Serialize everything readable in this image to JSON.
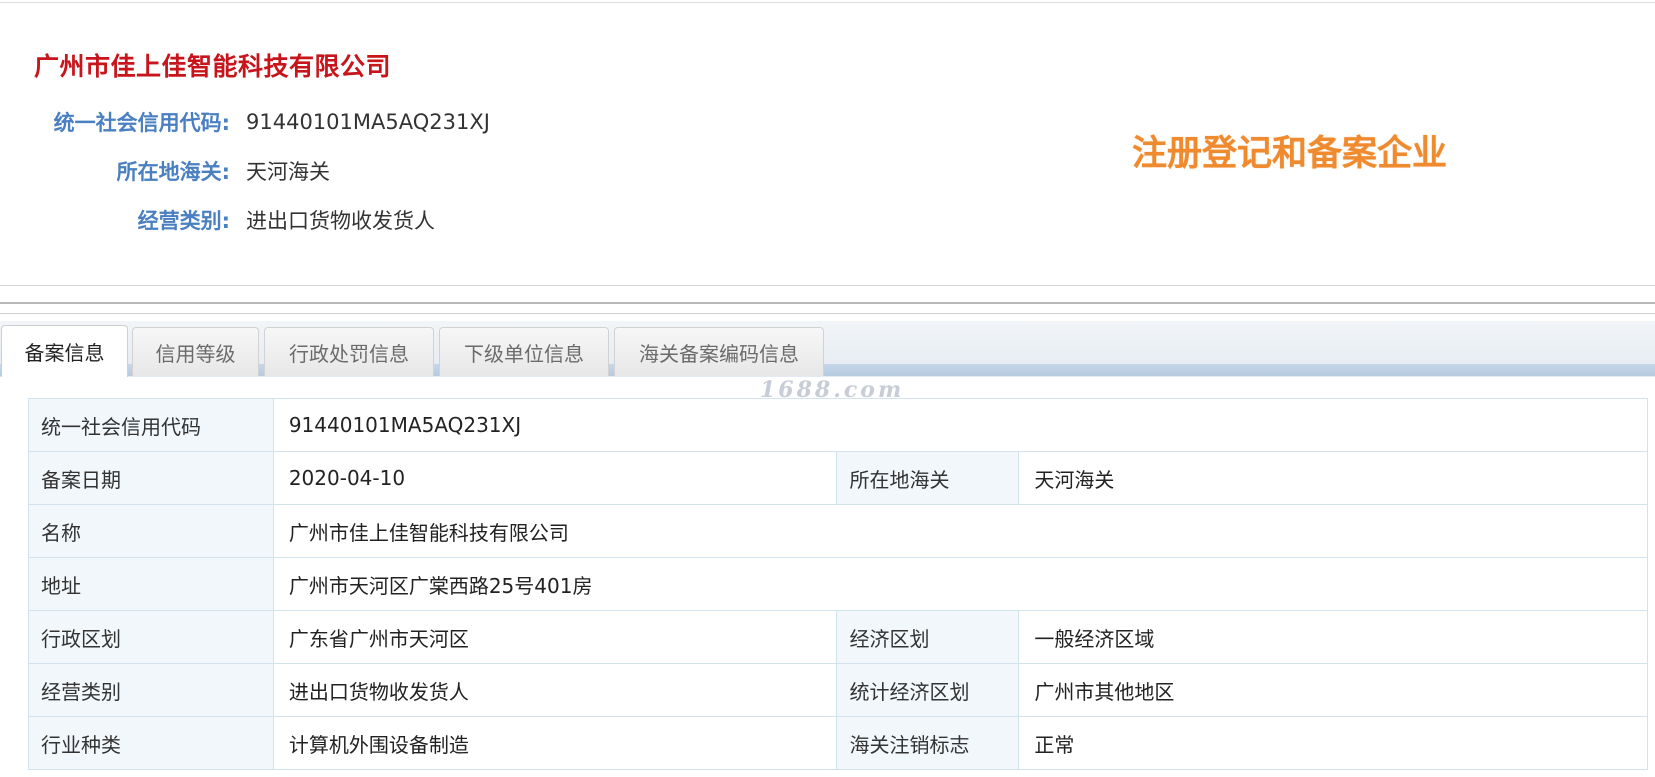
{
  "header": {
    "company_name": "广州市佳上佳智能科技有限公司",
    "fields": [
      {
        "label": "统一社会信用代码:",
        "value": "91440101MA5AQ231XJ"
      },
      {
        "label": "所在地海关:",
        "value": "天河海关"
      },
      {
        "label": "经营类别:",
        "value": "进出口货物收发货人"
      }
    ],
    "status_stamp": "注册登记和备案企业"
  },
  "tabs": [
    {
      "label": "备案信息",
      "active": true
    },
    {
      "label": "信用等级",
      "active": false
    },
    {
      "label": "行政处罚信息",
      "active": false
    },
    {
      "label": "下级单位信息",
      "active": false
    },
    {
      "label": "海关备案编码信息",
      "active": false
    }
  ],
  "watermark": "1688.com",
  "record_table": {
    "rows": [
      {
        "label1": "统一社会信用代码",
        "value1": "91440101MA5AQ231XJ"
      },
      {
        "label1": "备案日期",
        "value1": "2020-04-10",
        "label2": "所在地海关",
        "value2": "天河海关"
      },
      {
        "label1": "名称",
        "value1": "广州市佳上佳智能科技有限公司"
      },
      {
        "label1": "地址",
        "value1": "广州市天河区广棠西路25号401房"
      },
      {
        "label1": "行政区划",
        "value1": "广东省广州市天河区",
        "label2": "经济区划",
        "value2": "一般经济区域"
      },
      {
        "label1": "经营类别",
        "value1": "进出口货物收发货人",
        "label2": "统计经济区划",
        "value2": "广州市其他地区"
      },
      {
        "label1": "行业种类",
        "value1": "计算机外围设备制造",
        "label2": "海关注销标志",
        "value2": "正常"
      }
    ]
  },
  "colors": {
    "company_name": "#c8151b",
    "field_label": "#4a7fc1",
    "stamp": "#f08a2e",
    "table_label_bg": "#f2f7fb",
    "table_border": "#d3e3ec"
  }
}
